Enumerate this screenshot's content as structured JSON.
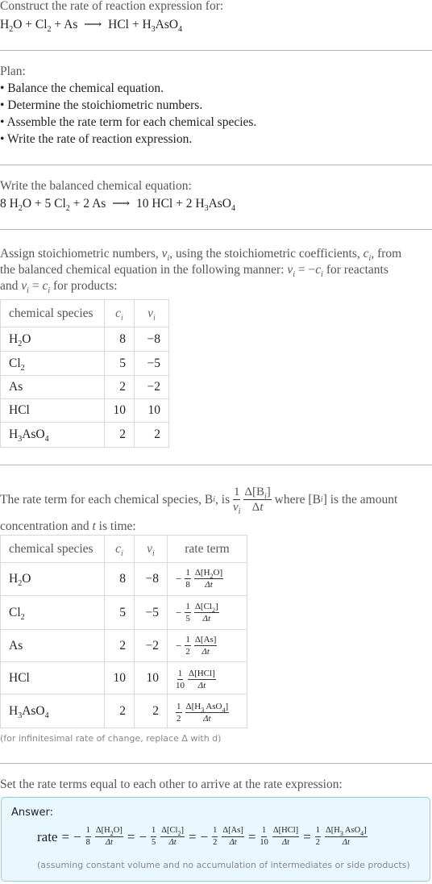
{
  "intro": {
    "heading": "Construct the rate of reaction expression for:",
    "equation": {
      "reactants": [
        "H2O",
        "Cl2",
        "As"
      ],
      "products": [
        "HCl",
        "H3AsO4"
      ]
    }
  },
  "plan": {
    "label": "Plan:",
    "steps": [
      "• Balance the chemical equation.",
      "• Determine the stoichiometric numbers.",
      "• Assemble the rate term for each chemical species.",
      "• Write the rate of reaction expression."
    ]
  },
  "balanced": {
    "label": "Write the balanced chemical equation:",
    "reactants": [
      {
        "coef": "8",
        "species": "H2O"
      },
      {
        "coef": "5",
        "species": "Cl2"
      },
      {
        "coef": "2",
        "species": "As"
      }
    ],
    "products": [
      {
        "coef": "10",
        "species": "HCl"
      },
      {
        "coef": "2",
        "species": "H3AsO4"
      }
    ]
  },
  "stoich": {
    "text_line1": "Assign stoichiometric numbers, νi, using the stoichiometric coefficients, ci, from",
    "text_line2": "the balanced chemical equation in the following manner: νi = −ci for reactants",
    "text_line3": "and νi = ci for products:",
    "headers": [
      "chemical species",
      "ci",
      "νi"
    ],
    "rows": [
      {
        "species": "H2O",
        "c": "8",
        "v": "−8"
      },
      {
        "species": "Cl2",
        "c": "5",
        "v": "−5"
      },
      {
        "species": "As",
        "c": "2",
        "v": "−2"
      },
      {
        "species": "HCl",
        "c": "10",
        "v": "10"
      },
      {
        "species": "H3AsO4",
        "c": "2",
        "v": "2"
      }
    ]
  },
  "rateterm": {
    "text_before": "The rate term for each chemical species, Bi, is",
    "text_after": "where [Bi] is the amount",
    "text_line2": "concentration and t is time:",
    "headers": [
      "chemical species",
      "ci",
      "νi",
      "rate term"
    ],
    "rows": [
      {
        "species": "H2O",
        "c": "8",
        "v": "−8",
        "sign": "−",
        "den": "8"
      },
      {
        "species": "Cl2",
        "c": "5",
        "v": "−5",
        "sign": "−",
        "den": "5"
      },
      {
        "species": "As",
        "c": "2",
        "v": "−2",
        "sign": "−",
        "den": "2"
      },
      {
        "species": "HCl",
        "c": "10",
        "v": "10",
        "sign": "",
        "den": "10"
      },
      {
        "species": "H3AsO4",
        "c": "2",
        "v": "2",
        "sign": "",
        "den": "2"
      }
    ],
    "footnote": "(for infinitesimal rate of change, replace Δ with d)"
  },
  "final": {
    "label": "Set the rate terms equal to each other to arrive at the rate expression:",
    "answer_label": "Answer:",
    "rate_word": "rate",
    "note": "(assuming constant volume and no accumulation of intermediates or side products)"
  },
  "colors": {
    "answer_bg": "#e8f8fe",
    "answer_border": "#8fcde0",
    "divider": "#b5b5b5"
  }
}
